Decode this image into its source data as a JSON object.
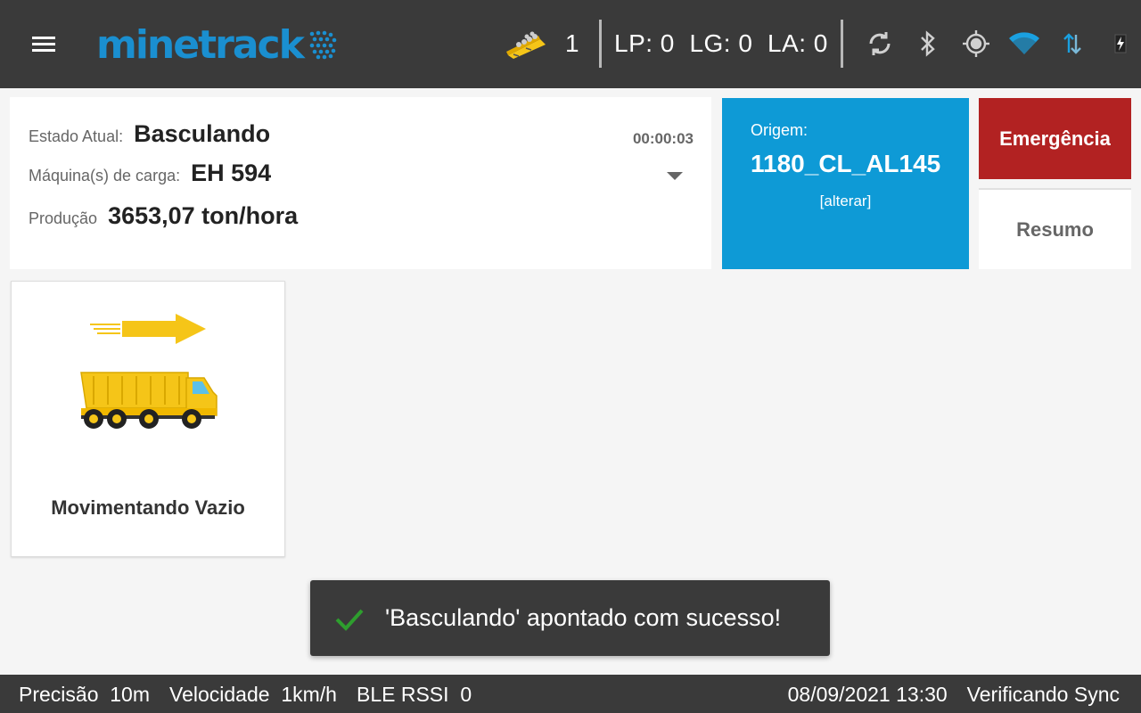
{
  "app": {
    "brand_text": "minetrack",
    "brand_color": "#1a8fd0"
  },
  "topbar": {
    "menu_icon": "hamburger-menu-icon",
    "load_count": "1",
    "lp_lg_la": "LP: 0  LG: 0  LA: 0",
    "icons": [
      "sync-icon",
      "bluetooth-icon",
      "gps-target-icon",
      "wifi-icon",
      "data-transfer-icon",
      "battery-charging-icon"
    ]
  },
  "status": {
    "estado_label": "Estado Atual:",
    "estado_value": "Basculando",
    "timer": "00:00:03",
    "maquina_label": "Máquina(s) de carga:",
    "maquina_value": "EH 594",
    "producao_label": "Produção",
    "producao_value": "3653,07 ton/hora"
  },
  "origem": {
    "label": "Origem:",
    "value": "1180_CL_AL145",
    "alter_link": "[alterar]",
    "bg_color": "#0e9ad6"
  },
  "buttons": {
    "emergencia": "Emergência",
    "emergencia_color": "#b22222",
    "resumo": "Resumo"
  },
  "actions": [
    {
      "label": "Movimentando Vazio",
      "icon": "empty-dump-truck-moving-icon"
    }
  ],
  "toast": {
    "message": "'Basculando' apontado com sucesso!",
    "icon": "check-icon",
    "icon_color": "#2e9e2e"
  },
  "bottombar": {
    "precisao_label": "Precisão",
    "precisao_value": "10m",
    "velocidade_label": "Velocidade",
    "velocidade_value": "1km/h",
    "ble_label": "BLE RSSI",
    "ble_value": "0",
    "datetime": "08/09/2021 13:30",
    "sync_status": "Verificando Sync"
  }
}
